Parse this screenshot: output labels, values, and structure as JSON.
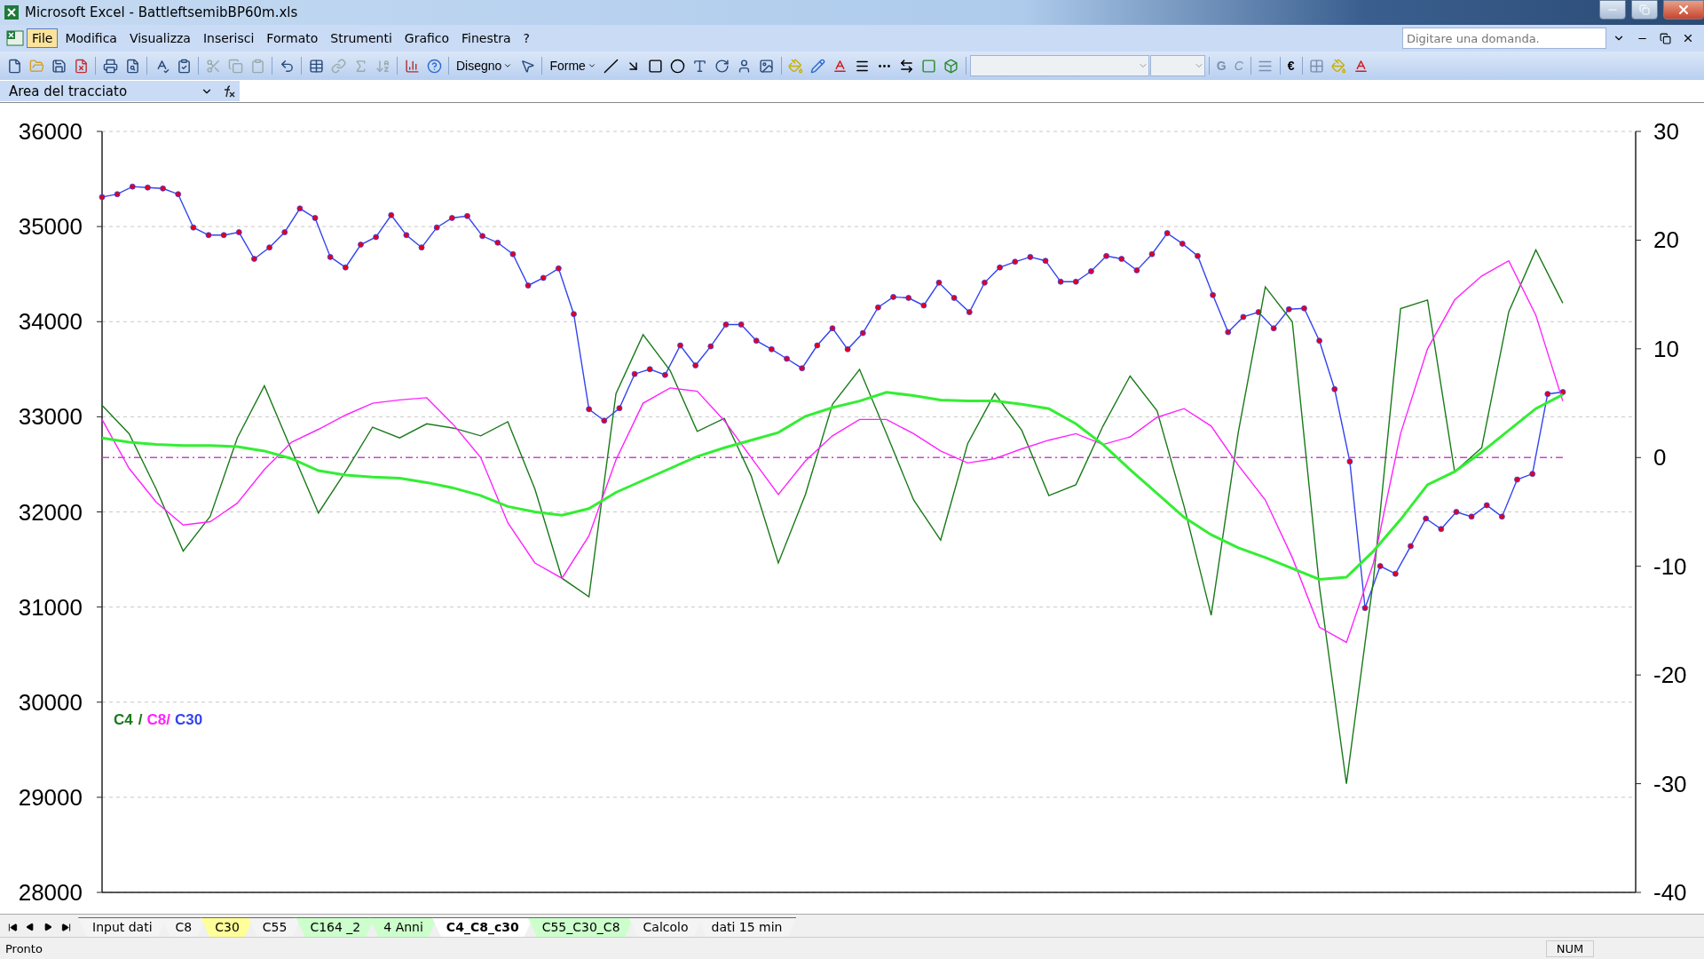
{
  "window": {
    "title": "Microsoft Excel - BattleftsemibBP60m.xls"
  },
  "menu": [
    {
      "label": "File",
      "selected": true
    },
    {
      "label": "Modifica",
      "selected": false
    },
    {
      "label": "Visualizza",
      "selected": false
    },
    {
      "label": "Inserisci",
      "selected": false
    },
    {
      "label": "Formato",
      "selected": false
    },
    {
      "label": "Strumenti",
      "selected": false
    },
    {
      "label": "Grafico",
      "selected": false
    },
    {
      "label": "Finestra",
      "selected": false
    },
    {
      "label": "?",
      "selected": false
    }
  ],
  "help_search": {
    "placeholder": "Digitare una domanda."
  },
  "drawing_toolbar": {
    "draw_menu": "Disegno",
    "shapes_menu": "Forme"
  },
  "format_toolbar": {
    "bold": "G",
    "italic": "C",
    "currency": "€"
  },
  "name_box": {
    "value": "Area del tracciato"
  },
  "price_chart": {
    "chart_data": {
      "type": "line",
      "grid": true,
      "ylim": [
        28000,
        36000
      ],
      "yticks": [
        28000,
        29000,
        30000,
        31000,
        32000,
        33000,
        34000,
        35000,
        36000
      ],
      "categories": [
        null,
        null,
        null,
        null,
        null,
        null,
        null,
        null,
        null,
        null,
        null,
        null,
        null,
        null,
        null,
        null,
        null,
        null,
        null,
        null,
        null,
        null,
        null,
        null,
        null,
        null,
        null,
        null,
        null,
        null,
        null,
        null,
        null,
        null,
        null,
        null,
        null,
        null,
        null,
        null,
        null,
        null,
        null,
        null,
        null,
        null,
        null,
        null,
        null,
        null,
        null,
        null,
        null,
        null,
        null,
        null,
        null,
        null,
        null,
        null,
        null,
        null,
        null,
        null,
        null,
        null,
        null,
        null,
        null,
        null,
        null,
        null,
        null,
        null,
        null,
        null,
        null,
        null,
        null,
        null,
        null,
        null,
        null,
        null,
        null,
        null,
        null,
        null,
        null,
        null,
        null,
        null,
        null,
        null,
        null,
        null,
        null
      ],
      "series": [
        {
          "name": "C30",
          "color": "#3344ee",
          "marker": "circle",
          "values": [
            35310,
            35340,
            35420,
            35410,
            35400,
            35340,
            34990,
            34910,
            34910,
            34940,
            34660,
            34780,
            34940,
            35190,
            35090,
            34680,
            34570,
            34810,
            34890,
            35120,
            34910,
            34780,
            34990,
            35090,
            35110,
            34900,
            34830,
            34710,
            34380,
            34460,
            34560,
            34080,
            33080,
            32960,
            33090,
            33450,
            33500,
            33440,
            33750,
            33540,
            33740,
            33970,
            33970,
            33800,
            33710,
            33610,
            33510,
            33750,
            33930,
            33710,
            33880,
            34150,
            34260,
            34250,
            34170,
            34410,
            34250,
            34100,
            34410,
            34570,
            34630,
            34680,
            34640,
            34420,
            34420,
            34530,
            34690,
            34660,
            34540,
            34710,
            34930,
            34820,
            34690,
            34280,
            33890,
            34050,
            34100,
            33930,
            34130,
            34140,
            33800,
            33290,
            32530,
            30990,
            31430,
            31350,
            31640,
            31930,
            31820,
            32000,
            31950,
            32070,
            31950,
            32340,
            32400,
            33240,
            33260
          ]
        }
      ]
    }
  },
  "oscillator_chart": {
    "chart_data": {
      "type": "line",
      "ref_lines": [
        {
          "axis": "y",
          "value": 0,
          "color": "#cc44cc"
        }
      ],
      "ylim": [
        -40,
        30
      ],
      "yticks": [
        -40,
        -30,
        -20,
        -10,
        0,
        10,
        20,
        30
      ],
      "categories": [
        null,
        null,
        null,
        null,
        null,
        null,
        null,
        null,
        null,
        null,
        null,
        null,
        null,
        null,
        null,
        null,
        null,
        null,
        null,
        null,
        null,
        null,
        null,
        null,
        null,
        null,
        null,
        null,
        null,
        null,
        null,
        null,
        null,
        null,
        null,
        null,
        null,
        null,
        null,
        null,
        null,
        null,
        null,
        null,
        null,
        null,
        null,
        null,
        null,
        null,
        null,
        null,
        null,
        null,
        null
      ],
      "series": [
        {
          "name": "C4",
          "color": "#1a7a1a",
          "values": [
            4.8,
            2.2,
            -2.9,
            -8.6,
            -5.4,
            1.8,
            6.6,
            0.7,
            -5.1,
            -1.3,
            2.8,
            1.8,
            3.1,
            2.7,
            2,
            3.3,
            -2.9,
            -11.1,
            -12.8,
            5.9,
            11.3,
            8,
            2.4,
            3.6,
            -1.7,
            -9.7,
            -3.4,
            4.9,
            8.1,
            2.2,
            -3.9,
            -7.6,
            1.3,
            5.9,
            2.5,
            -3.5,
            -2.5,
            2.9,
            7.5,
            4.3,
            -4.5,
            -14.5,
            2.3,
            15.7,
            12.5,
            -11.8,
            -30,
            -11.2,
            13.7,
            14.5,
            -1.3,
            0.9,
            13.4,
            19.1,
            14.2
          ]
        },
        {
          "name": "C8",
          "color": "#ff22ff",
          "values": [
            3.5,
            -1,
            -4.1,
            -6.2,
            -5.9,
            -4.2,
            -1.1,
            1.4,
            2.6,
            3.9,
            5,
            5.3,
            5.5,
            3,
            0,
            -6,
            -9.7,
            -11.1,
            -7.2,
            -0.2,
            5,
            6.4,
            6.1,
            3.4,
            0,
            -3.4,
            -0.3,
            2,
            3.5,
            3.5,
            2.2,
            0.6,
            -0.5,
            -0.1,
            0.8,
            1.6,
            2.2,
            1.2,
            1.9,
            3.7,
            4.5,
            2.9,
            -0.7,
            -3.9,
            -9.2,
            -15.6,
            -17,
            -9.7,
            2.2,
            10,
            14.5,
            16.7,
            18.1,
            13.1,
            5.2
          ]
        },
        {
          "color": "#33ee33",
          "values": [
            1.8,
            1.4,
            1.2,
            1.1,
            1.1,
            1,
            0.6,
            -0.1,
            -1.2,
            -1.6,
            -1.8,
            -1.9,
            -2.3,
            -2.8,
            -3.5,
            -4.5,
            -5,
            -5.3,
            -4.7,
            -3.2,
            -2.1,
            -1,
            0.1,
            0.9,
            1.6,
            2.3,
            3.8,
            4.6,
            5.2,
            6,
            5.7,
            5.3,
            5.2,
            5.2,
            4.9,
            4.5,
            3.1,
            1.2,
            -1.1,
            -3.3,
            -5.5,
            -7.1,
            -8.3,
            -9.2,
            -10.2,
            -11.2,
            -11,
            -8.6,
            -5.7,
            -2.5,
            -1.3,
            0.5,
            2.5,
            4.5,
            5.8
          ]
        }
      ]
    },
    "legend_separators": [
      "/",
      "/"
    ]
  },
  "sheet_tabs": [
    {
      "label": "Input dati",
      "selected": false,
      "color": "#f4f4f4"
    },
    {
      "label": "C8",
      "selected": false,
      "color": "#f4f4f4"
    },
    {
      "label": "C30",
      "selected": false,
      "color": "#ffff99"
    },
    {
      "label": "C55",
      "selected": false,
      "color": "#f4f4f4"
    },
    {
      "label": "C164 _2",
      "selected": false,
      "color": "#ccffcc"
    },
    {
      "label": "4 Anni",
      "selected": false,
      "color": "#ccffcc"
    },
    {
      "label": "C4_C8_c30",
      "selected": true,
      "color": "#ffffff"
    },
    {
      "label": "C55_C30_C8",
      "selected": false,
      "color": "#ccffcc"
    },
    {
      "label": "Calcolo",
      "selected": false,
      "color": "#f4f4f4"
    },
    {
      "label": "dati 15 min",
      "selected": false,
      "color": "#f4f4f4"
    }
  ],
  "status_bar": {
    "text": "Pronto",
    "indicators": [
      "NUM"
    ]
  }
}
